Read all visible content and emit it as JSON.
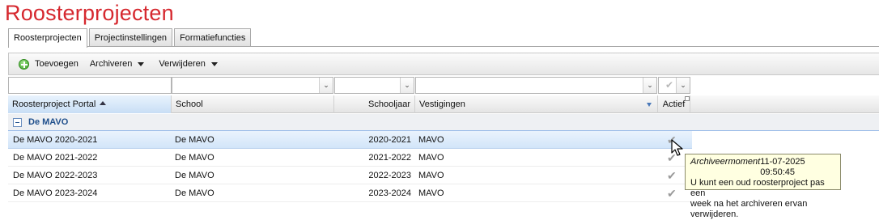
{
  "page": {
    "title": "Roosterprojecten"
  },
  "tabs": [
    {
      "label": "Roosterprojecten",
      "active": true
    },
    {
      "label": "Projectinstellingen",
      "active": false
    },
    {
      "label": "Formatiefuncties",
      "active": false
    }
  ],
  "toolbar": {
    "add_label": "Toevoegen",
    "archive_label": "Archiveren",
    "delete_label": "Verwijderen"
  },
  "grid": {
    "columns": {
      "project": "Roosterproject Portal",
      "school": "School",
      "year": "Schooljaar",
      "locations": "Vestigingen",
      "active": "Actief"
    },
    "group": {
      "label": "De MAVO"
    },
    "rows": [
      {
        "project": "De MAVO 2020-2021",
        "school": "De MAVO",
        "year": "2020-2021",
        "locations": "MAVO",
        "active": true,
        "selected": true
      },
      {
        "project": "De MAVO 2021-2022",
        "school": "De MAVO",
        "year": "2021-2022",
        "locations": "MAVO",
        "active": true,
        "selected": false
      },
      {
        "project": "De MAVO 2022-2023",
        "school": "De MAVO",
        "year": "2022-2023",
        "locations": "MAVO",
        "active": true,
        "selected": false
      },
      {
        "project": "De MAVO 2023-2024",
        "school": "De MAVO",
        "year": "2023-2024",
        "locations": "MAVO",
        "active": true,
        "selected": false
      }
    ]
  },
  "tooltip": {
    "label": "Archiveermoment",
    "timestamp": "11-07-2025 09:50:45",
    "line1": "U kunt een oud roosterproject pas een",
    "line2": "week na het archiveren ervan verwijderen."
  },
  "colors": {
    "title": "#d6282f",
    "group_text": "#1f4f8c",
    "tooltip_bg": "#ffffe1"
  }
}
